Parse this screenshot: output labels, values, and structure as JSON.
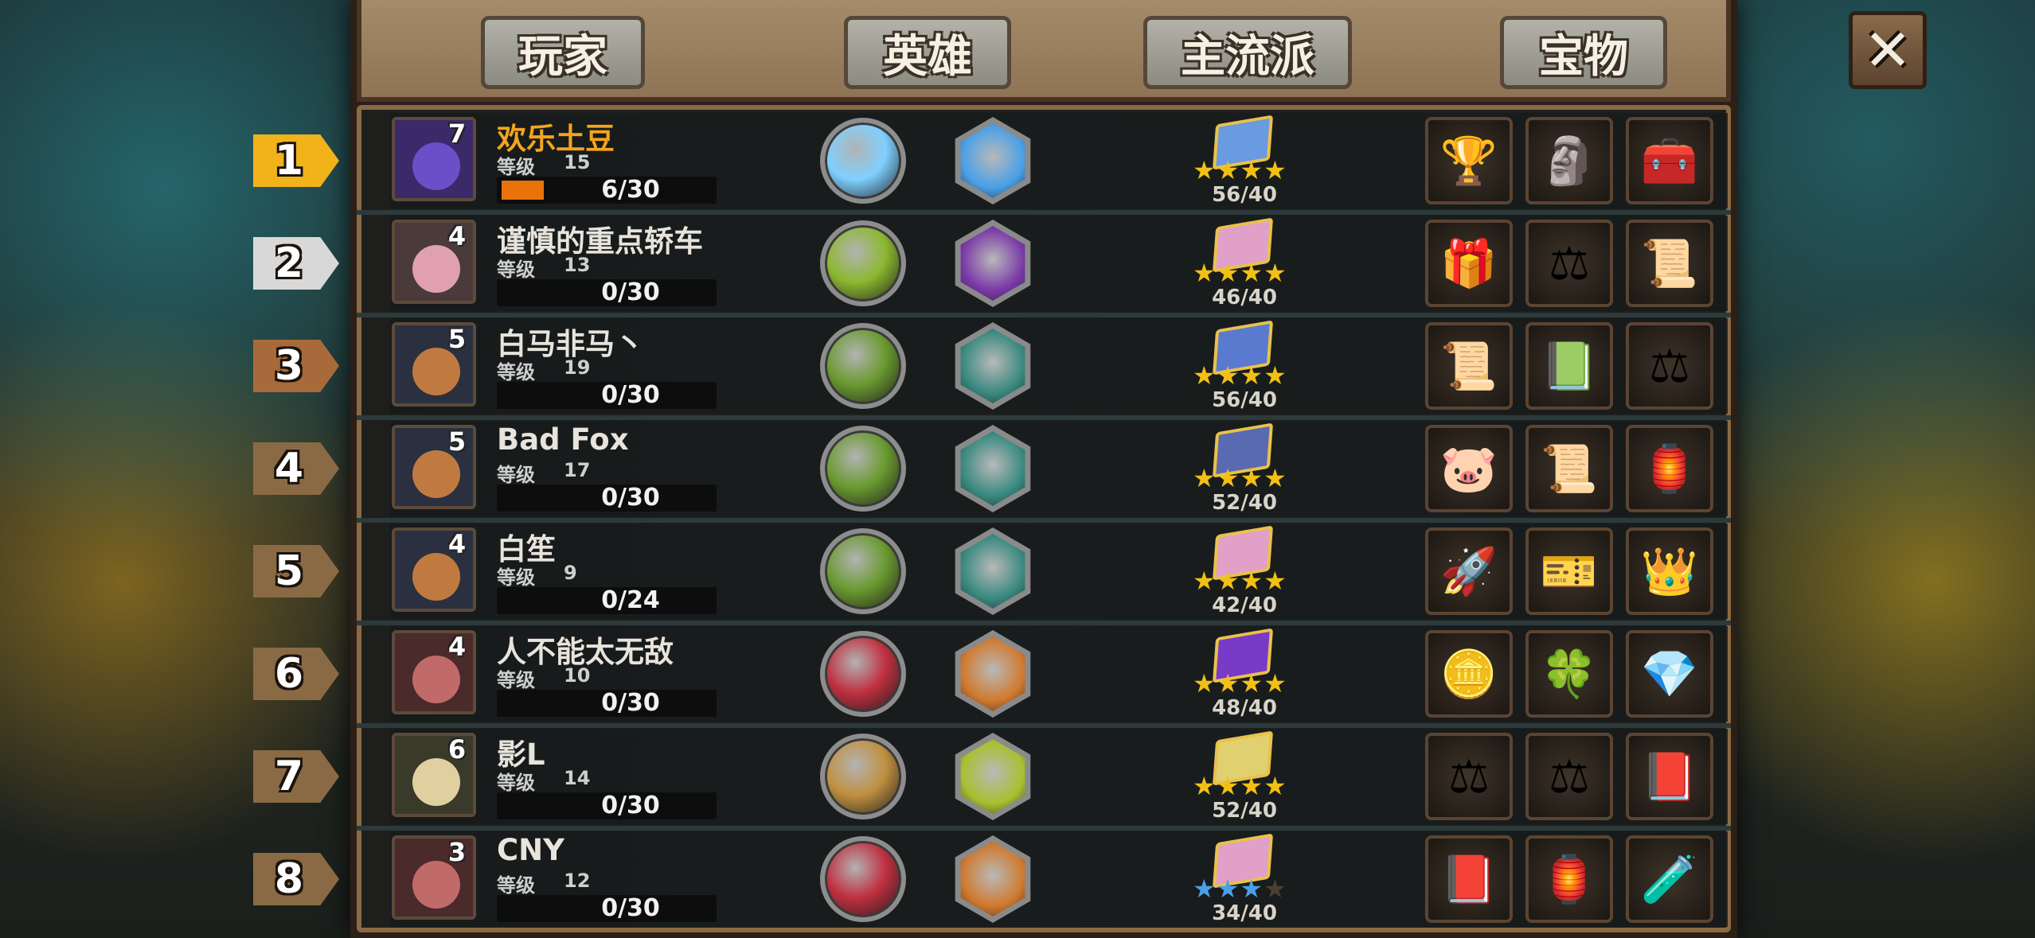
{
  "tabs": [
    {
      "label": "玩家"
    },
    {
      "label": "英雄"
    },
    {
      "label": "主流派"
    },
    {
      "label": "宝物"
    }
  ],
  "close_label": "✕",
  "level_label": "等级",
  "rows": [
    {
      "rank": "1",
      "name": "欢乐土豆",
      "badge": "7",
      "level": "15",
      "xp": "6/30",
      "xp_fraction": 0.2,
      "stars": 4,
      "max_stars": 4,
      "score": "56/40",
      "star_color": "#f2c014",
      "avatar_color": "#3a2a6a",
      "face_color": "#6b4fc8",
      "circle_color": "#7fd0ff",
      "hex_color": "#4aa0e8",
      "book_color": "#6a9ae0",
      "items": [
        "🏆",
        "🗿",
        "🧰"
      ]
    },
    {
      "rank": "2",
      "name": "谨慎的重点轿车",
      "badge": "4",
      "level": "13",
      "xp": "0/30",
      "xp_fraction": 0,
      "stars": 4,
      "max_stars": 4,
      "score": "46/40",
      "star_color": "#f2c014",
      "avatar_color": "#4a3a3a",
      "face_color": "#e0a0b0",
      "circle_color": "#8cb830",
      "hex_color": "#7a3aa8",
      "book_color": "#e0a0c8",
      "items": [
        "🎁",
        "⚖",
        "📜"
      ]
    },
    {
      "rank": "3",
      "name": "白马非马丶",
      "badge": "5",
      "level": "19",
      "xp": "0/30",
      "xp_fraction": 0,
      "stars": 4,
      "max_stars": 4,
      "score": "56/40",
      "star_color": "#f2c014",
      "avatar_color": "#2a3040",
      "face_color": "#c07a40",
      "circle_color": "#6a9a30",
      "hex_color": "#3a8a80",
      "book_color": "#5a7ad0",
      "items": [
        "📜",
        "📗",
        "⚖"
      ]
    },
    {
      "rank": "4",
      "name": "Bad Fox",
      "badge": "5",
      "level": "17",
      "xp": "0/30",
      "xp_fraction": 0,
      "stars": 4,
      "max_stars": 4,
      "score": "52/40",
      "star_color": "#f2c014",
      "avatar_color": "#2a3040",
      "face_color": "#c07a40",
      "circle_color": "#6a9a30",
      "hex_color": "#3a8a80",
      "book_color": "#5a6ab0",
      "items": [
        "🐷",
        "📜",
        "🏮"
      ]
    },
    {
      "rank": "5",
      "name": "白笙",
      "badge": "4",
      "level": "9",
      "xp": "0/24",
      "xp_fraction": 0,
      "stars": 4,
      "max_stars": 4,
      "score": "42/40",
      "star_color": "#f2c014",
      "avatar_color": "#2a3040",
      "face_color": "#c07a40",
      "circle_color": "#6a9a30",
      "hex_color": "#3a8a80",
      "book_color": "#e0a0c8",
      "items": [
        "🚀",
        "🎫",
        "👑"
      ]
    },
    {
      "rank": "6",
      "name": "人不能太无敌",
      "badge": "4",
      "level": "10",
      "xp": "0/30",
      "xp_fraction": 0,
      "stars": 4,
      "max_stars": 4,
      "score": "48/40",
      "star_color": "#f2c014",
      "avatar_color": "#4a2a2a",
      "face_color": "#c06a6a",
      "circle_color": "#c03040",
      "hex_color": "#d07a30",
      "book_color": "#7a3ac8",
      "items": [
        "🪙",
        "🍀",
        "💎"
      ]
    },
    {
      "rank": "7",
      "name": "影L",
      "badge": "6",
      "level": "14",
      "xp": "0/30",
      "xp_fraction": 0,
      "stars": 4,
      "max_stars": 4,
      "score": "52/40",
      "star_color": "#f2c014",
      "avatar_color": "#3a3a2a",
      "face_color": "#e0d0a0",
      "circle_color": "#c09040",
      "hex_color": "#a8c030",
      "book_color": "#e0d070",
      "items": [
        "⚖",
        "⚖",
        "📕"
      ]
    },
    {
      "rank": "8",
      "name": "CNY",
      "badge": "3",
      "level": "12",
      "xp": "0/30",
      "xp_fraction": 0,
      "stars": 3,
      "max_stars": 4,
      "score": "34/40",
      "star_color": "#4aa0e8",
      "avatar_color": "#4a2a2a",
      "face_color": "#c06a6a",
      "circle_color": "#c03040",
      "hex_color": "#d07a30",
      "book_color": "#e0a0c8",
      "items": [
        "📕",
        "🏮",
        "🧪"
      ]
    }
  ]
}
